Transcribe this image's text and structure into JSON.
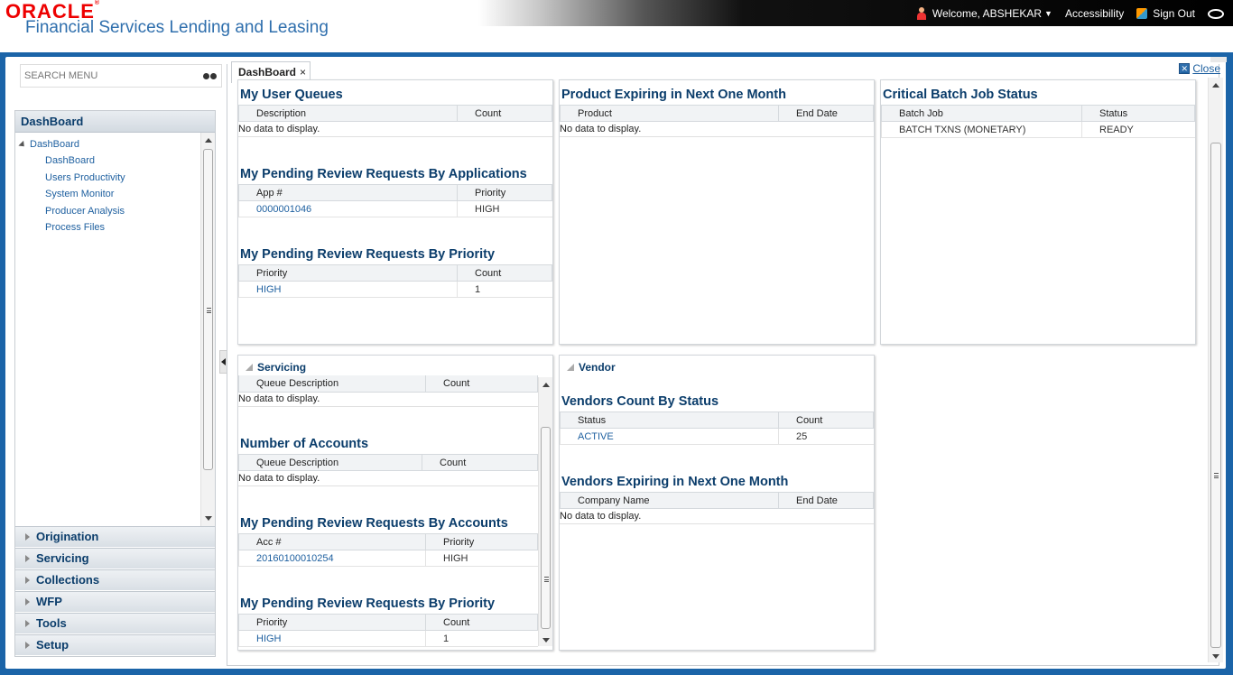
{
  "header": {
    "logo": "ORACLE",
    "product": "Financial Services Lending and Leasing",
    "welcome": "Welcome, ABSHEKAR",
    "accessibility": "Accessibility",
    "signout": "Sign Out"
  },
  "search": {
    "placeholder": "SEARCH MENU"
  },
  "nav": {
    "header": "DashBoard",
    "root": "DashBoard",
    "items": [
      "DashBoard",
      "Users Productivity",
      "System Monitor",
      "Producer Analysis",
      "Process Files"
    ],
    "accordions": [
      "Origination",
      "Servicing",
      "Collections",
      "WFP",
      "Tools",
      "Setup"
    ]
  },
  "tab": {
    "label": "DashBoard",
    "close_glyph": "×"
  },
  "close": {
    "label": "Close"
  },
  "panels": {
    "user_queues": {
      "title": "My User Queues",
      "cols": [
        "Description",
        "Count"
      ],
      "nodata": "No data to display."
    },
    "pending_by_app": {
      "title": "My Pending Review Requests By Applications",
      "cols": [
        "App #",
        "Priority"
      ],
      "rows": [
        [
          "0000001046",
          "HIGH"
        ]
      ]
    },
    "pending_by_priority": {
      "title": "My Pending Review Requests By Priority",
      "cols": [
        "Priority",
        "Count"
      ],
      "rows": [
        [
          "HIGH",
          "1"
        ]
      ]
    },
    "product_expiring": {
      "title": "Product Expiring in Next One Month",
      "cols": [
        "Product",
        "End Date"
      ],
      "nodata": "No data to display."
    },
    "batch": {
      "title": "Critical Batch Job Status",
      "cols": [
        "Batch Job",
        "Status"
      ],
      "rows": [
        [
          "BATCH TXNS (MONETARY)",
          "READY"
        ]
      ]
    },
    "servicing": {
      "header": "Servicing",
      "queue_cols": [
        "Queue Description",
        "Count"
      ],
      "queue_nodata": "No data to display.",
      "accounts_title": "Number of Accounts",
      "accounts_cols": [
        "Queue Description",
        "Count"
      ],
      "accounts_nodata": "No data to display.",
      "by_accounts_title": "My Pending Review Requests By Accounts",
      "by_accounts_cols": [
        "Acc #",
        "Priority"
      ],
      "by_accounts_rows": [
        [
          "20160100010254",
          "HIGH"
        ]
      ],
      "by_priority_title": "My Pending Review Requests By Priority",
      "by_priority_cols": [
        "Priority",
        "Count"
      ],
      "by_priority_rows": [
        [
          "HIGH",
          "1"
        ]
      ]
    },
    "vendor": {
      "header": "Vendor",
      "count_title": "Vendors Count By Status",
      "count_cols": [
        "Status",
        "Count"
      ],
      "count_rows": [
        [
          "ACTIVE",
          "25"
        ]
      ],
      "expiring_title": "Vendors Expiring in Next One Month",
      "expiring_cols": [
        "Company Name",
        "End Date"
      ],
      "expiring_nodata": "No data to display."
    }
  }
}
